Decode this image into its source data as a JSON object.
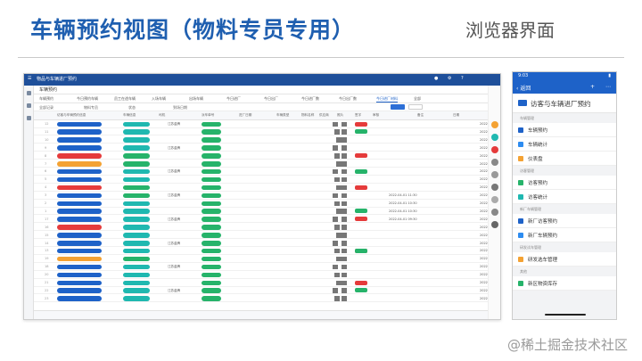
{
  "slide": {
    "title": "车辆预约视图（物料专员专用）",
    "subtitle": "浏览器界面",
    "watermark": "@稀土掘金技术社区"
  },
  "browser": {
    "app_name": "物品与车辆进厂预约",
    "tab_title": "车辆预约",
    "views": [
      "车辆预约",
      "今日预约车辆",
      "员工在途车辆",
      "入场车辆",
      "出场车辆",
      "今日进厂",
      "今日出厂",
      "今日进厂数",
      "今日出厂数",
      "今日进厂材料",
      "全部"
    ],
    "active_view_index": 9,
    "filter_labels": [
      "全部记录",
      "物料专员",
      "状态",
      "到场日期"
    ],
    "column_headers": [
      "访客与车辆预约信息",
      "车辆信息",
      "司机",
      "派车单号",
      "进厂日期",
      "车辆类型",
      "物料名称",
      "供应商",
      "照片",
      "签字",
      "审核",
      "备注",
      "日期"
    ],
    "row_numbers": [
      "12",
      "11",
      "10",
      "9",
      "8",
      "7",
      "6",
      "5",
      "4",
      "3",
      "2",
      "1",
      "17",
      "16",
      "15",
      "14",
      "13",
      "19",
      "18",
      "20",
      "21",
      "22",
      "23"
    ],
    "sample_text": [
      "江苏金牌",
      "苏州吴中仓储",
      "华信",
      "预约中",
      "已预约",
      "已进厂",
      "已出厂",
      "2022-06"
    ],
    "sample_dates": [
      "2022-04-01 11:30",
      "2022-04-01 10:30",
      "2022-04-01 10:30",
      "2022-04-01 09:30"
    ],
    "year_label": "2022-0",
    "colors": {
      "primary": "#1e4f9a",
      "accent": "#1e62c8",
      "green": "#26b36a",
      "red": "#e53b3b",
      "orange": "#f4a233",
      "teal": "#1fb8b0"
    }
  },
  "phone": {
    "time": "9:03",
    "back_label": "返回",
    "hero_title": "访客与车辆进厂预约",
    "sections": [
      {
        "title": "车辆管理",
        "items": [
          "车辆预约",
          "车辆统计",
          "仪表盘"
        ]
      },
      {
        "title": "访客管理",
        "items": [
          "访客预约",
          "访客统计"
        ]
      },
      {
        "title": "新厂车辆管理",
        "items": [
          "新厂访客预约",
          "新厂车辆预约"
        ]
      },
      {
        "title": "研发试车管理",
        "items": [
          "研发选车管理"
        ]
      },
      {
        "title": "其他",
        "items": [
          "新区物资库存"
        ]
      }
    ]
  }
}
